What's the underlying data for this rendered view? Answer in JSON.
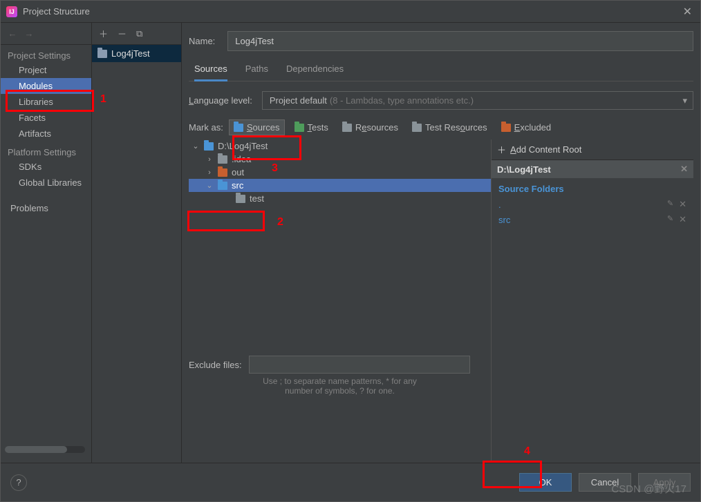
{
  "window": {
    "title": "Project Structure"
  },
  "sidebar": {
    "sections": {
      "project": "Project Settings",
      "platform": "Platform Settings"
    },
    "items": [
      "Project",
      "Modules",
      "Libraries",
      "Facets",
      "Artifacts"
    ],
    "platform_items": [
      "SDKs",
      "Global Libraries"
    ],
    "problems": "Problems"
  },
  "modules_list": {
    "item0": "Log4jTest"
  },
  "form": {
    "name_label": "Name:",
    "name_value": "Log4jTest",
    "tabs": [
      "Sources",
      "Paths",
      "Dependencies"
    ],
    "lang_label": "Language level:",
    "lang_value": "Project default",
    "lang_hint": "(8 - Lambdas, type annotations etc.)",
    "mark_label": "Mark as:",
    "marks": {
      "sources": "Sources",
      "tests": "Tests",
      "resources": "Resources",
      "test_resources": "Test Resources",
      "excluded": "Excluded"
    },
    "tree": {
      "root": "D:\\Log4jTest",
      "idea": ".idea",
      "out": "out",
      "src": "src",
      "test": "test"
    },
    "roots": {
      "add": "Add Content Root",
      "path": "D:\\Log4jTest",
      "section": "Source Folders",
      "entries": [
        ".",
        "src"
      ]
    },
    "exclude_label": "Exclude files:",
    "exclude_hint1": "Use ; to separate name patterns, * for any",
    "exclude_hint2": "number of symbols, ? for one."
  },
  "footer": {
    "ok": "OK",
    "cancel": "Cancel",
    "apply": "Apply"
  },
  "annotations": {
    "a1": "1",
    "a2": "2",
    "a3": "3",
    "a4": "4"
  },
  "watermark": "CSDN @野火17"
}
